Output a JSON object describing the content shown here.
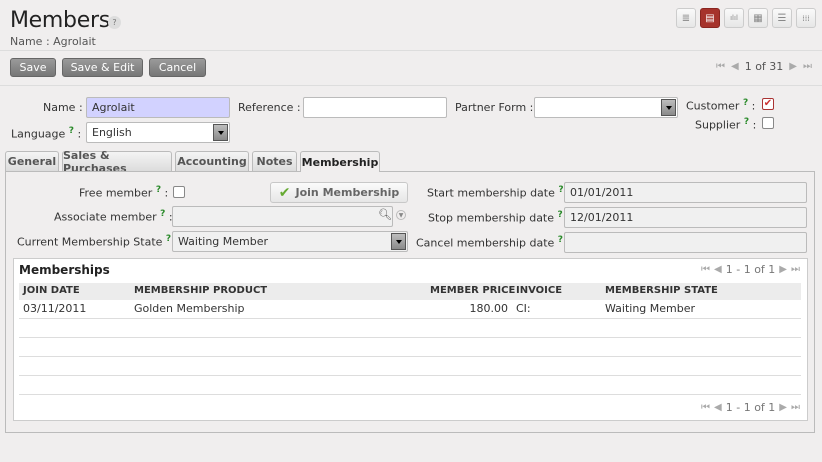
{
  "header": {
    "title": "Members",
    "help": "?",
    "breadcrumb": "Name : Agrolait"
  },
  "view_buttons": [
    {
      "icon": "list-view-icon",
      "glyph": "≣"
    },
    {
      "icon": "form-view-icon",
      "glyph": "▤",
      "active": true
    },
    {
      "icon": "graph-view-icon",
      "glyph": "ılıl"
    },
    {
      "icon": "calendar-view-icon",
      "glyph": "▦"
    },
    {
      "icon": "gantt-view-icon",
      "glyph": "☰"
    },
    {
      "icon": "kanban-view-icon",
      "glyph": "⁞⁞⁞"
    }
  ],
  "toolbar": {
    "save": "Save",
    "save_edit": "Save & Edit",
    "cancel": "Cancel"
  },
  "pager": {
    "first": "⏮",
    "prev": "◀",
    "count": "1 of 31",
    "next": "▶",
    "last": "⏭"
  },
  "form": {
    "name_label": "Name :",
    "name_value": "Agrolait",
    "reference_label": "Reference :",
    "reference_value": "",
    "partner_form_label": "Partner Form :",
    "partner_form_value": "",
    "customer_label": "Customer",
    "customer_checked": true,
    "supplier_label": "Supplier",
    "supplier_checked": false,
    "language_label": "Language",
    "language_value": "English",
    "help_mark": "?",
    "colon": ":"
  },
  "tabs": [
    {
      "label": "General"
    },
    {
      "label": "Sales & Purchases"
    },
    {
      "label": "Accounting"
    },
    {
      "label": "Notes"
    },
    {
      "label": "Membership",
      "active": true
    }
  ],
  "membership": {
    "free_member_label": "Free member",
    "free_member_checked": false,
    "join_button": "Join Membership",
    "associate_member_label": "Associate member",
    "associate_member_value": "",
    "state_label": "Current Membership State",
    "state_value": "Waiting Member",
    "start_label": "Start membership date",
    "start_value": "01/01/2011",
    "stop_label": "Stop membership date",
    "stop_value": "12/01/2011",
    "cancel_label": "Cancel membership date",
    "cancel_value": ""
  },
  "memberships_list": {
    "title": "Memberships",
    "pager_count": "1 - 1 of 1",
    "columns": [
      "JOIN DATE",
      "MEMBERSHIP PRODUCT",
      "MEMBER PRICE",
      "INVOICE",
      "MEMBERSHIP STATE"
    ],
    "rows": [
      {
        "join_date": "03/11/2011",
        "product": "Golden Membership",
        "price": "180.00",
        "invoice": "CI:",
        "state": "Waiting Member"
      }
    ]
  }
}
